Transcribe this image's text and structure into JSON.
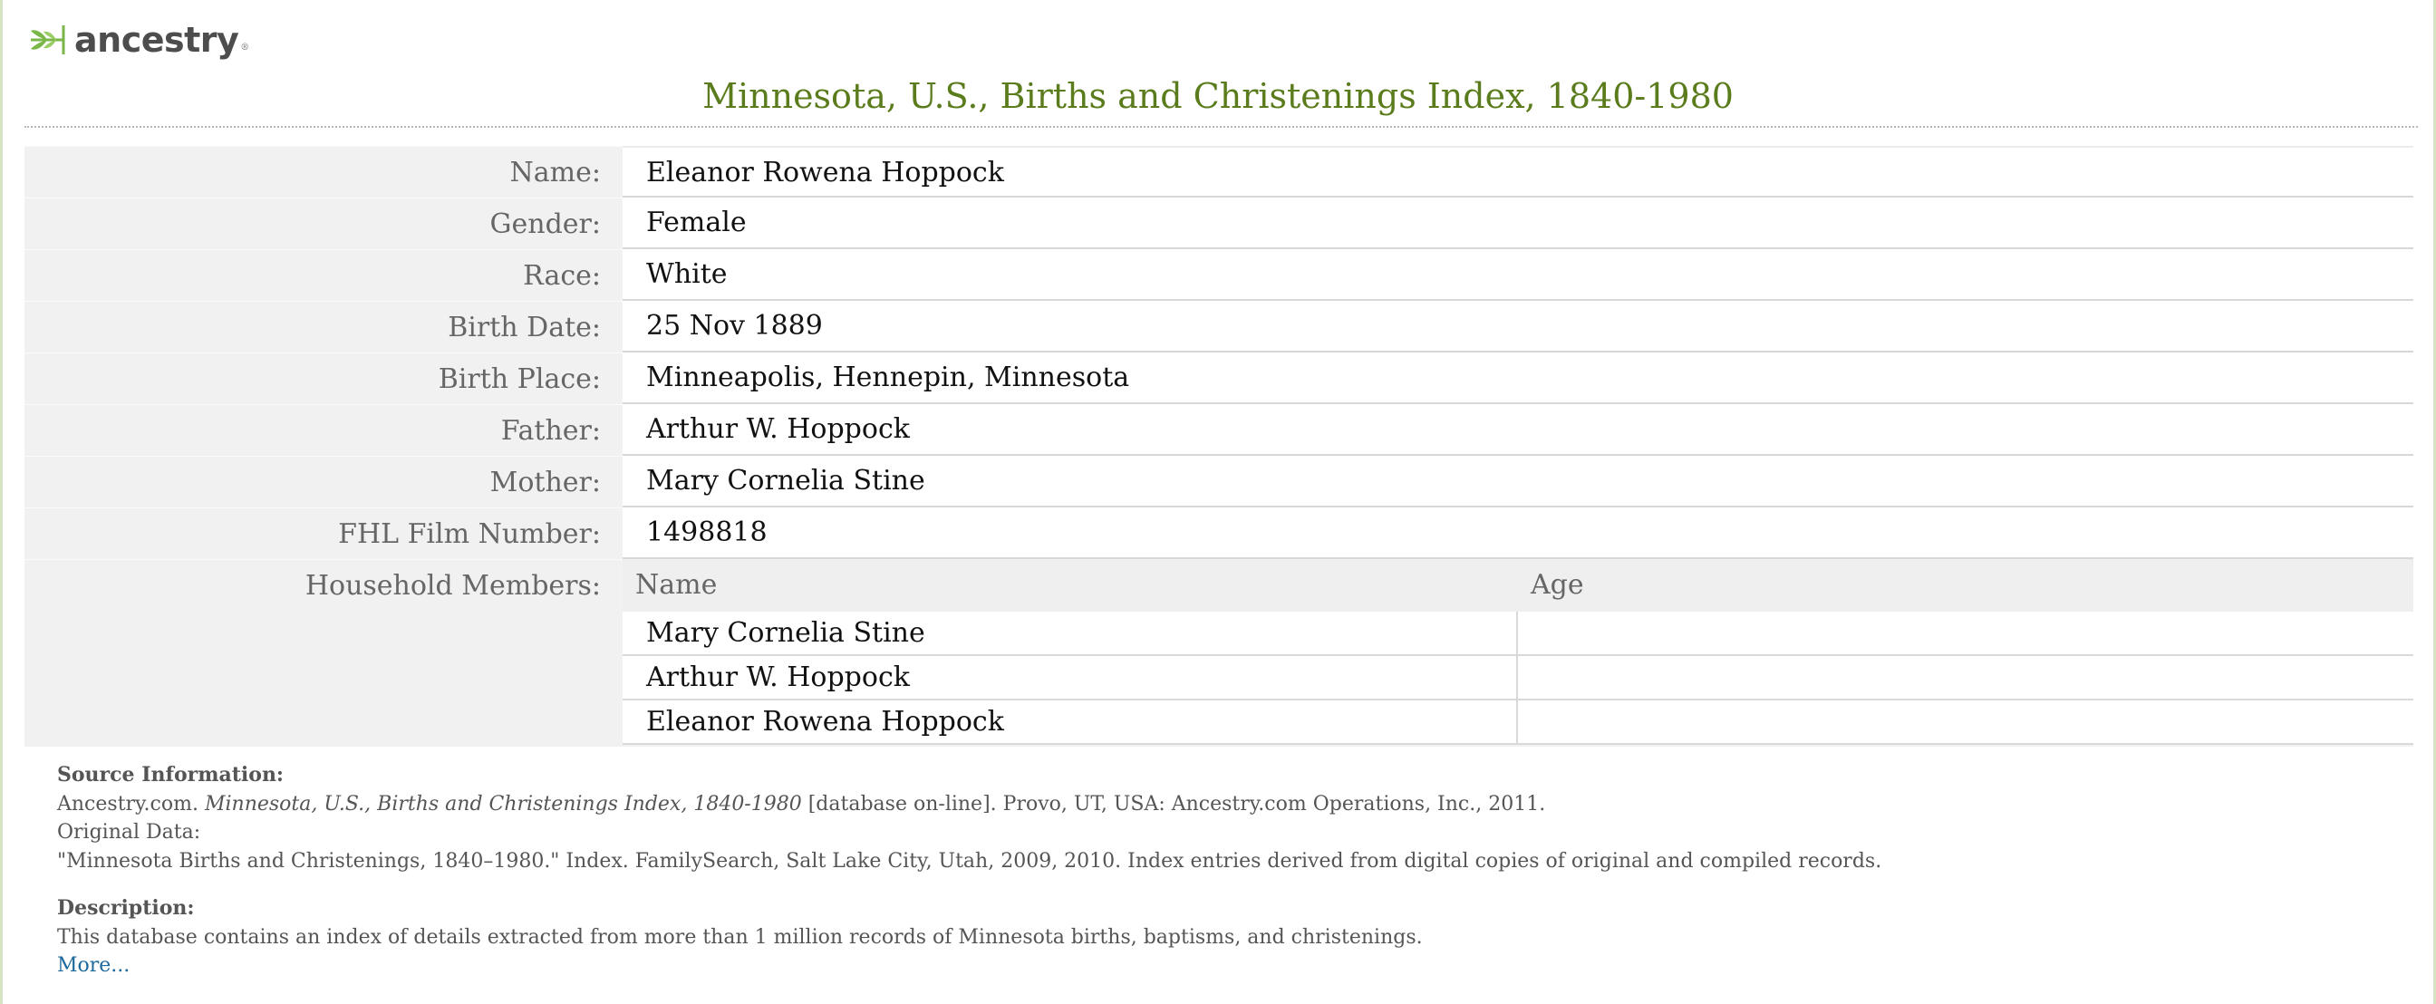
{
  "brand": {
    "name": "ancestry",
    "tm": "®",
    "icon": "leaf-logo-icon",
    "accent": "#7ab648"
  },
  "page": {
    "title": "Minnesota, U.S., Births and Christenings Index, 1840-1980",
    "title_color": "#5b7c1c"
  },
  "record": {
    "fields": [
      {
        "label": "Name:",
        "value": "Eleanor Rowena Hoppock"
      },
      {
        "label": "Gender:",
        "value": "Female"
      },
      {
        "label": "Race:",
        "value": "White"
      },
      {
        "label": "Birth Date:",
        "value": "25 Nov 1889"
      },
      {
        "label": "Birth Place:",
        "value": "Minneapolis, Hennepin, Minnesota"
      },
      {
        "label": "Father:",
        "value": "Arthur W. Hoppock"
      },
      {
        "label": "Mother:",
        "value": "Mary Cornelia Stine"
      },
      {
        "label": "FHL Film Number:",
        "value": "1498818"
      }
    ],
    "household": {
      "label": "Household Members:",
      "columns": [
        "Name",
        "Age"
      ],
      "rows": [
        {
          "name": "Mary Cornelia Stine",
          "age": ""
        },
        {
          "name": "Arthur W. Hoppock",
          "age": ""
        },
        {
          "name": "Eleanor Rowena Hoppock",
          "age": ""
        }
      ]
    }
  },
  "source": {
    "heading": "Source Information:",
    "citation_prefix": "Ancestry.com. ",
    "citation_title": "Minnesota, U.S., Births and Christenings Index, 1840-1980",
    "citation_suffix": " [database on-line]. Provo, UT, USA: Ancestry.com Operations, Inc., 2011.",
    "original_label": "Original Data:",
    "original_text": "\"Minnesota Births and Christenings, 1840–1980.\" Index. FamilySearch, Salt Lake City, Utah, 2009, 2010. Index entries derived from digital copies of original and compiled records."
  },
  "description": {
    "heading": "Description:",
    "text": "This database contains an index of details extracted from more than 1 million records of Minnesota births, baptisms, and christenings.",
    "more_link": "More..."
  }
}
